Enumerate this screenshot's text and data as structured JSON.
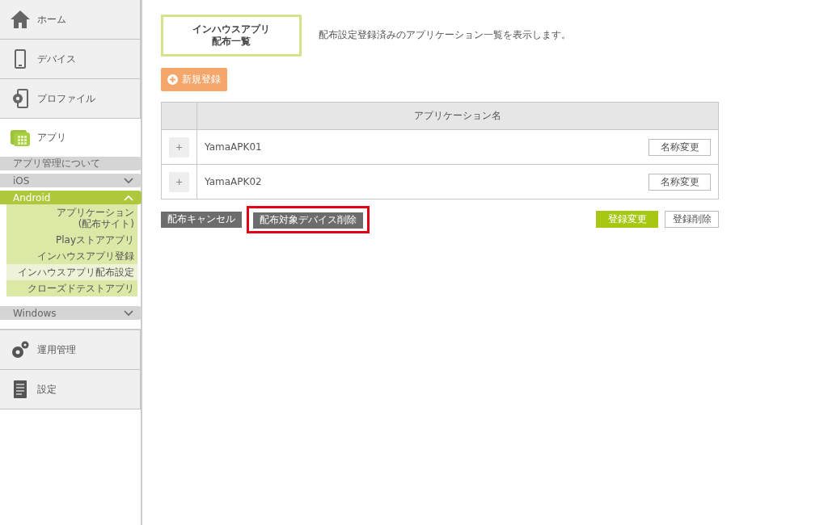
{
  "sidebar": {
    "nav_top": [
      {
        "label": "ホーム",
        "kind": "home",
        "selected": false
      },
      {
        "label": "デバイス",
        "kind": "device",
        "selected": false
      },
      {
        "label": "プロファイル",
        "kind": "profile",
        "selected": false
      },
      {
        "label": "アプリ",
        "kind": "app",
        "selected": true
      }
    ],
    "app_menu": [
      {
        "label": "アプリ管理について",
        "kind": "plain"
      },
      {
        "label": "iOS",
        "kind": "dropdown",
        "expanded": false
      },
      {
        "label": "Android",
        "kind": "dropdown",
        "expanded": true,
        "children": [
          {
            "label": "アプリケーション\n(配布サイト)",
            "selected": false
          },
          {
            "label": "Playストアアプリ",
            "selected": false
          },
          {
            "label": "インハウスアプリ登録",
            "selected": false
          },
          {
            "label": "インハウスアプリ配布設定",
            "selected": true
          },
          {
            "label": "クローズドテストアプリ",
            "selected": false
          }
        ]
      },
      {
        "label": "Windows",
        "kind": "dropdown",
        "expanded": false
      }
    ],
    "nav_bottom": [
      {
        "label": "運用管理",
        "kind": "gears",
        "selected": false
      },
      {
        "label": "設定",
        "kind": "document",
        "selected": false
      }
    ]
  },
  "main": {
    "title_lines": [
      "インハウスアプリ",
      "配布一覧"
    ],
    "description": "配布設定登録済みのアプリケーション一覧を表示します。",
    "new_button": "新規登録",
    "table": {
      "columns": [
        "アプリケーション名"
      ],
      "rows": [
        {
          "expand": "+",
          "name": "YamaAPK01",
          "rename": "名称変更"
        },
        {
          "expand": "+",
          "name": "YamaAPK02",
          "rename": "名称変更"
        }
      ]
    },
    "actions_left": [
      {
        "label": "配布キャンセル",
        "highlighted": false
      },
      {
        "label": "配布対象デバイス削除",
        "highlighted": true
      }
    ],
    "actions_right": [
      {
        "label": "登録変更",
        "kind": "primary"
      },
      {
        "label": "登録削除",
        "kind": "outline"
      }
    ]
  }
}
